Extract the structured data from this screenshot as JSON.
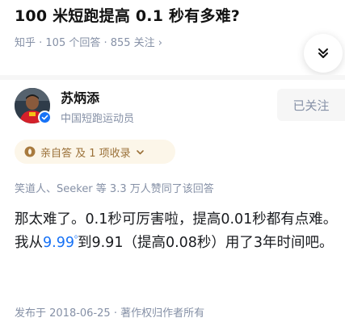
{
  "question": {
    "title": "100 米短跑提高 0.1 秒有多难?",
    "meta": "知乎 · 105 个回答 · 855 关注",
    "meta_chevron": "›",
    "collapse_icon": "double-chevron-down-icon"
  },
  "author": {
    "name": "苏炳添",
    "headline": "中国短跑运动员",
    "verified_icon": "verified-check-icon",
    "follow_label": "已关注"
  },
  "tag": {
    "icon": "coin-icon",
    "label": "亲自答 及 1 项收录",
    "chevron_icon": "chevron-down-icon"
  },
  "voters": "笑道人、Seeker 等 3.3 万人赞同了该回答",
  "answer": {
    "part1": "那太难了。0.1秒可厉害啦，提高0.01秒都有点难。我从",
    "highlight": "9.99",
    "sup": "⁰",
    "part2": "到9.91（提高0.08秒）用了3年时间吧。"
  },
  "footer": "发布于 2018-06-25 · 著作权归作者所有",
  "colors": {
    "brand_blue": "#1772f6",
    "meta_gray": "#8590a6",
    "tag_bg": "#fcf6e9",
    "tag_text": "#9a7038"
  }
}
